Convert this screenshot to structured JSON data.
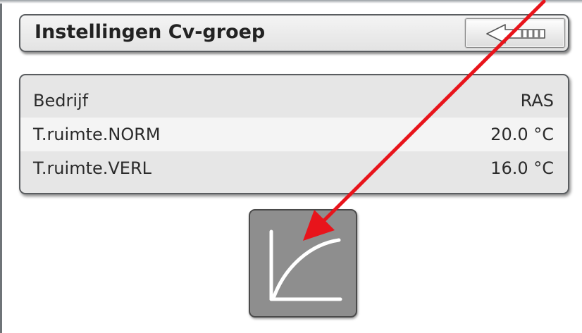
{
  "header": {
    "title": "Instellingen Cv-groep",
    "back_button_icon": "back-arrow-icon"
  },
  "settings": {
    "rows": [
      {
        "label": "Bedrijf",
        "value": "RAS"
      },
      {
        "label": "T.ruimte.NORM",
        "value": "20.0 °C"
      },
      {
        "label": "T.ruimte.VERL",
        "value": "16.0 °C"
      }
    ]
  },
  "curve_button": {
    "icon": "heating-curve-icon"
  },
  "annotation": {
    "icon": "red-arrow-icon",
    "color": "#e8141b"
  },
  "colors": {
    "panel_background": "#e6e6e6",
    "row_alt_background": "#f4f4f4",
    "button_gray": "#8e8e8e",
    "border": "#5a5d60",
    "text": "#2b2b2b"
  }
}
